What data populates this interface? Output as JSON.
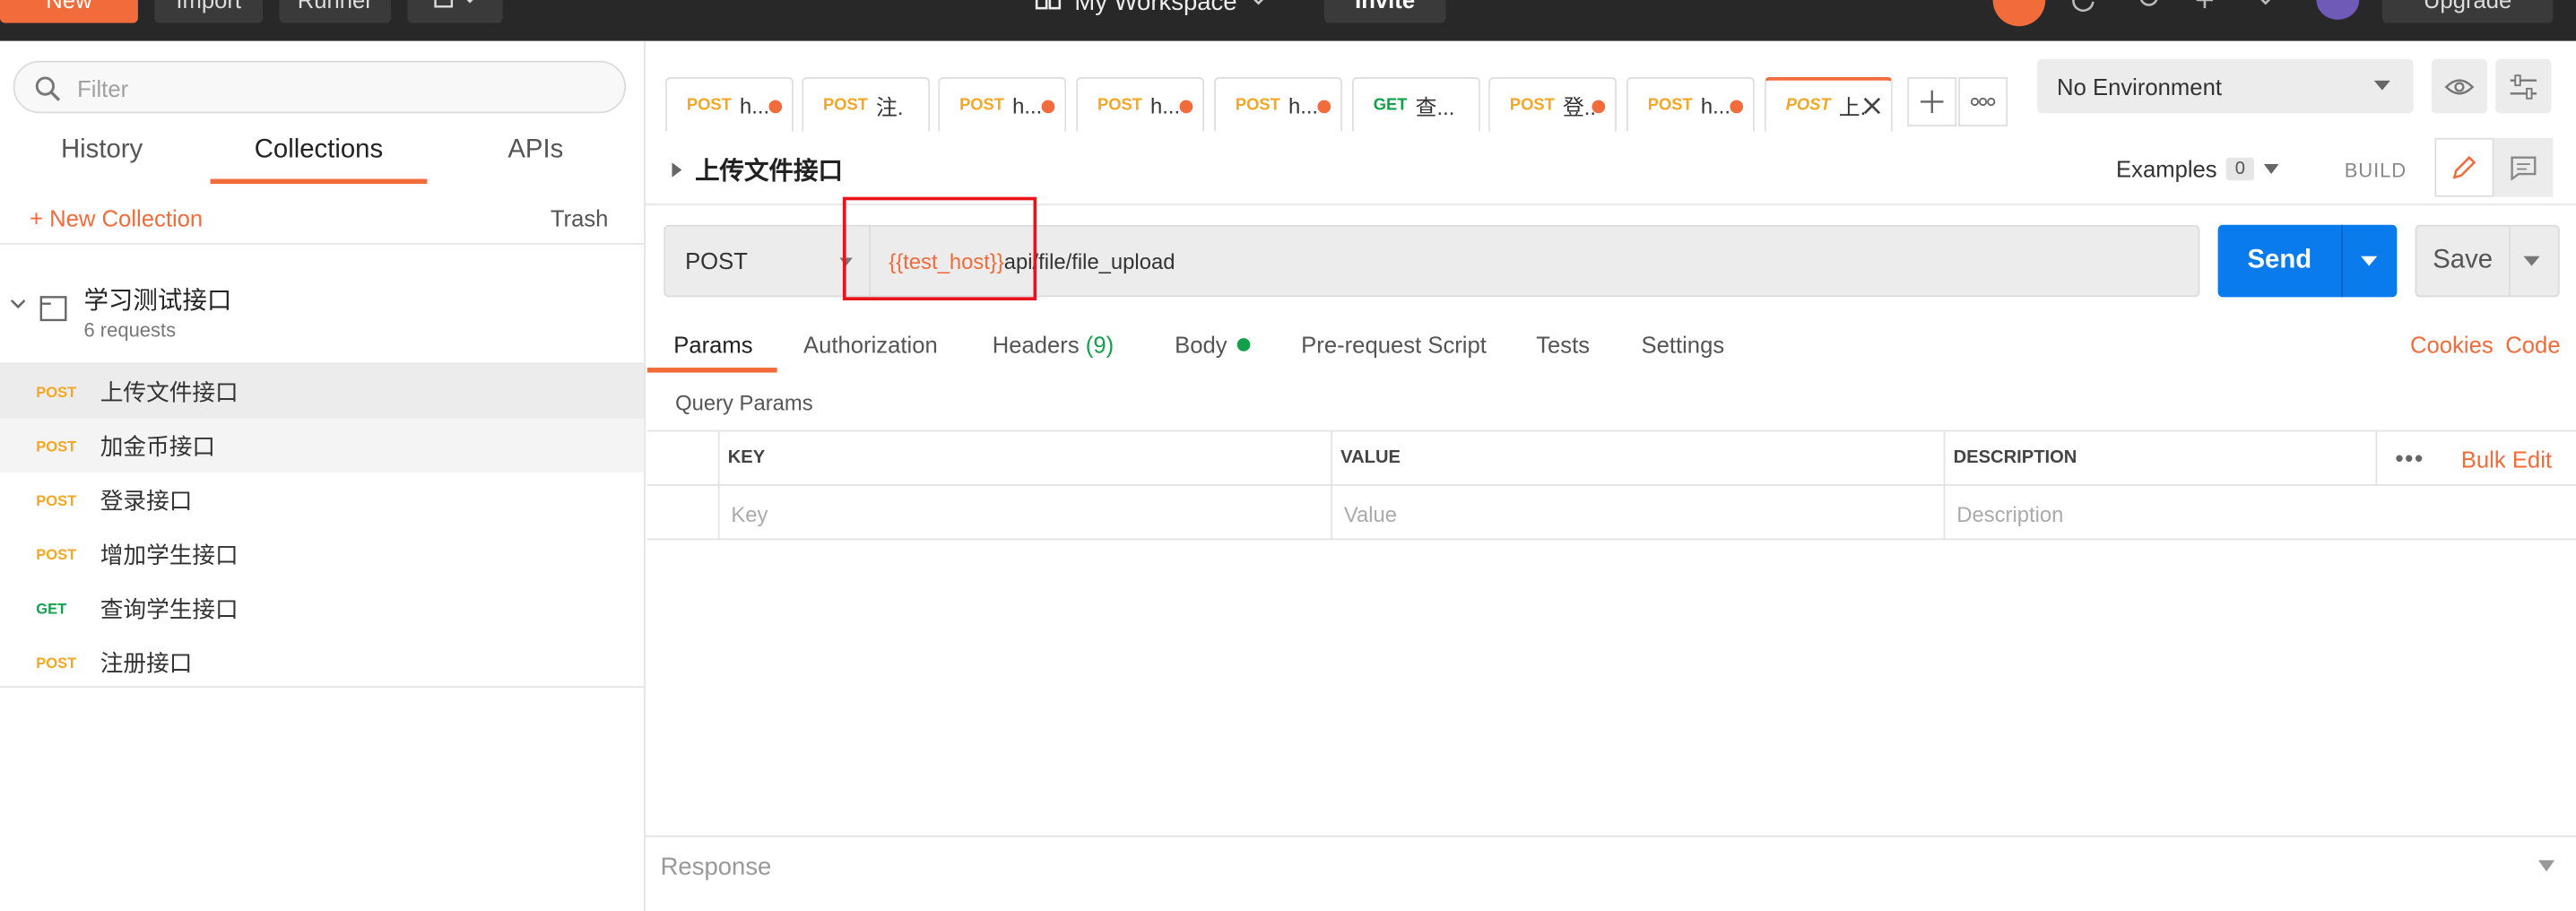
{
  "topbar": {
    "new_label": "New",
    "import_label": "Import",
    "runner_label": "Runner",
    "workspace_name": "My Workspace",
    "invite_label": "Invite",
    "upgrade_label": "Upgrade"
  },
  "sidebar": {
    "filter_placeholder": "Filter",
    "tabs": [
      "History",
      "Collections",
      "APIs"
    ],
    "new_collection_label": "+ New Collection",
    "trash_label": "Trash",
    "collection": {
      "name": "学习测试接口",
      "count": "6 requests"
    },
    "requests": [
      {
        "method": "POST",
        "name": "上传文件接口"
      },
      {
        "method": "POST",
        "name": "加金币接口"
      },
      {
        "method": "POST",
        "name": "登录接口"
      },
      {
        "method": "POST",
        "name": "增加学生接口"
      },
      {
        "method": "GET",
        "name": "查询学生接口"
      },
      {
        "method": "POST",
        "name": "注册接口"
      }
    ]
  },
  "tabs": [
    {
      "method": "POST",
      "title": "h..."
    },
    {
      "method": "POST",
      "title": "注."
    },
    {
      "method": "POST",
      "title": "h..."
    },
    {
      "method": "POST",
      "title": "h..."
    },
    {
      "method": "POST",
      "title": "h..."
    },
    {
      "method": "GET",
      "title": "查..."
    },
    {
      "method": "POST",
      "title": "登.."
    },
    {
      "method": "POST",
      "title": "h..."
    },
    {
      "method": "POST",
      "title": "上."
    }
  ],
  "environment": {
    "selected": "No Environment"
  },
  "request": {
    "title": "上传文件接口",
    "examples_label": "Examples",
    "examples_count": "0",
    "build_label": "BUILD",
    "method": "POST",
    "url_variable": "{{test_host}}",
    "url_path": "api/file/file_upload",
    "send_label": "Send",
    "save_label": "Save",
    "subtabs": {
      "params": "Params",
      "authorization": "Authorization",
      "headers": "Headers",
      "headers_count": "(9)",
      "body": "Body",
      "prerequest": "Pre-request Script",
      "tests": "Tests",
      "settings": "Settings"
    },
    "cookies_label": "Cookies",
    "code_label": "Code",
    "query_params_label": "Query Params",
    "table": {
      "headers": [
        "KEY",
        "VALUE",
        "DESCRIPTION"
      ],
      "placeholders": [
        "Key",
        "Value",
        "Description"
      ],
      "more_label": "•••",
      "bulk_edit_label": "Bulk Edit"
    }
  },
  "response": {
    "label": "Response"
  },
  "colors": {
    "accent": "#f26b3a",
    "send": "#097bed",
    "post": "#f5a623",
    "get": "#12a04a",
    "highlight_box": "#e8131b"
  }
}
